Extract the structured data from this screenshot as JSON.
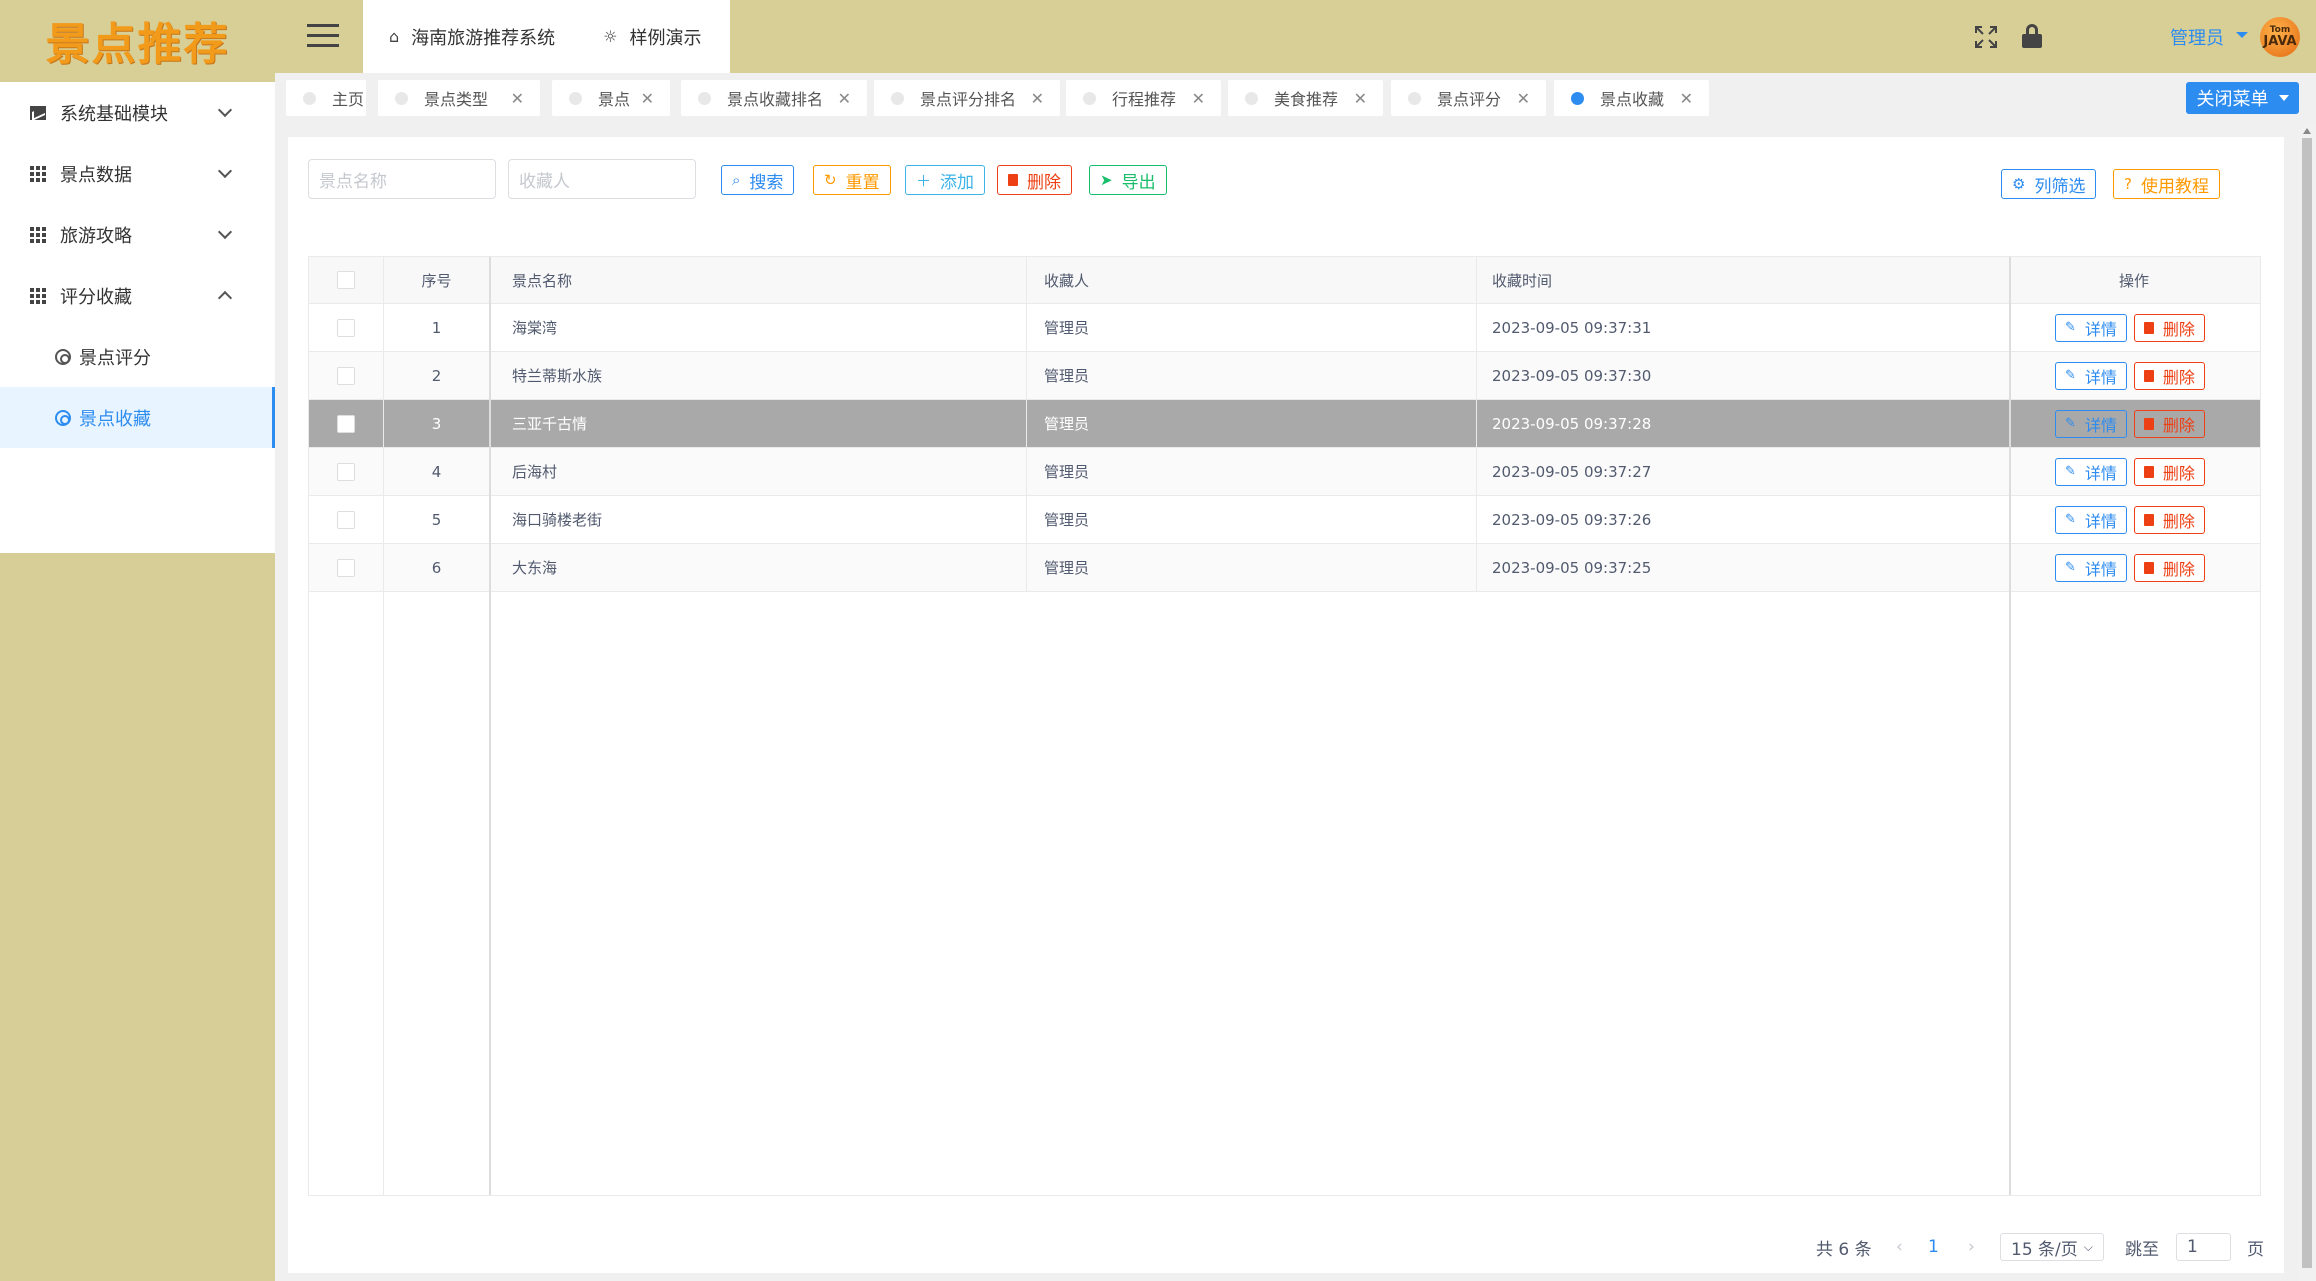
{
  "logo": "景点推荐",
  "sidebar": {
    "items": [
      {
        "label": "系统基础模块"
      },
      {
        "label": "景点数据"
      },
      {
        "label": "旅游攻略"
      },
      {
        "label": "评分收藏"
      }
    ],
    "sub_items": [
      {
        "label": "景点评分"
      },
      {
        "label": "景点收藏"
      }
    ]
  },
  "header": {
    "nav": [
      {
        "label": "海南旅游推荐系统",
        "icon": "home-icon"
      },
      {
        "label": "样例演示",
        "icon": "lightbulb-icon"
      }
    ],
    "user": "管理员",
    "avatar_text_top": "Tom",
    "avatar_text_bottom": "JAVA"
  },
  "tabs": [
    {
      "label": "主页"
    },
    {
      "label": "景点类型"
    },
    {
      "label": "景点"
    },
    {
      "label": "景点收藏排名"
    },
    {
      "label": "景点评分排名"
    },
    {
      "label": "行程推荐"
    },
    {
      "label": "美食推荐"
    },
    {
      "label": "景点评分"
    },
    {
      "label": "景点收藏"
    }
  ],
  "close_menu": "关闭菜单",
  "filters": {
    "name_placeholder": "景点名称",
    "collector_placeholder": "收藏人"
  },
  "toolbar": {
    "search": "搜索",
    "reset": "重置",
    "add": "添加",
    "delete": "删除",
    "export": "导出",
    "column_filter": "列筛选",
    "tutorial": "使用教程"
  },
  "table": {
    "headers": {
      "index": "序号",
      "name": "景点名称",
      "collector": "收藏人",
      "time": "收藏时间",
      "actions": "操作"
    },
    "detail_label": "详情",
    "delete_label": "删除",
    "rows": [
      {
        "index": "1",
        "name": "海棠湾",
        "collector": "管理员",
        "time": "2023-09-05 09:37:31"
      },
      {
        "index": "2",
        "name": "特兰蒂斯水族",
        "collector": "管理员",
        "time": "2023-09-05 09:37:30"
      },
      {
        "index": "3",
        "name": "三亚千古情",
        "collector": "管理员",
        "time": "2023-09-05 09:37:28"
      },
      {
        "index": "4",
        "name": "后海村",
        "collector": "管理员",
        "time": "2023-09-05 09:37:27"
      },
      {
        "index": "5",
        "name": "海口骑楼老街",
        "collector": "管理员",
        "time": "2023-09-05 09:37:26"
      },
      {
        "index": "6",
        "name": "大东海",
        "collector": "管理员",
        "time": "2023-09-05 09:37:25"
      }
    ]
  },
  "pager": {
    "total": "共 6 条",
    "current": "1",
    "page_size": "15 条/页",
    "jump_label": "跳至",
    "jump_value": "1",
    "page_unit": "页"
  },
  "colors": {
    "accent": "#2d8cf0",
    "sidebar_bg": "#d6cd97",
    "logo": "#f29b1b",
    "selected_row": "#a9a9a9"
  }
}
